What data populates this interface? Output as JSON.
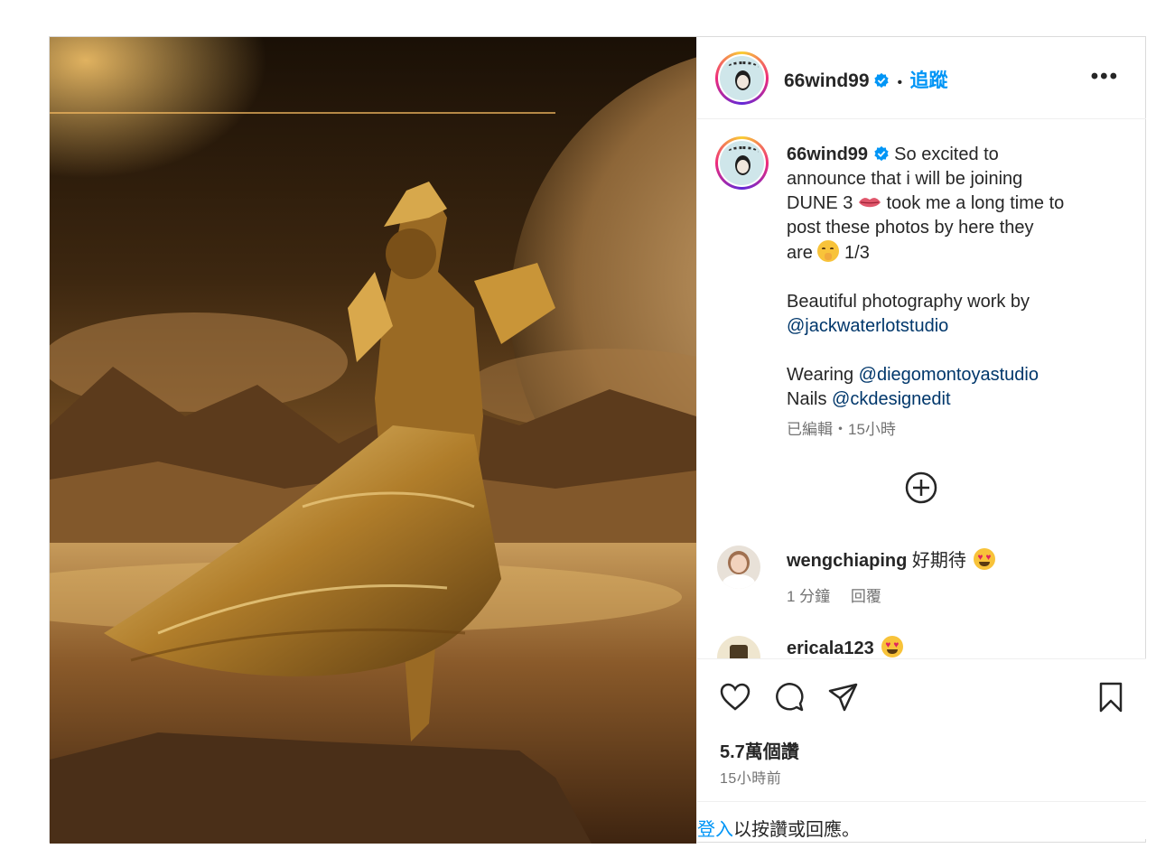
{
  "post": {
    "username": "66wind99",
    "follow_label": "追蹤",
    "dot": "•",
    "more_label": "•••",
    "caption": {
      "line1": "So excited to",
      "line2": "announce that i will be joining",
      "line3": "DUNE 3",
      "line3b": " took me a long time to",
      "line4": "post these photos by here they",
      "line5": "are",
      "line5b": " 1/3",
      "credit": "Beautiful photography work by",
      "credit_link": "@jackwaterlotstudio",
      "wearing": "Wearing ",
      "wearing_link": "@diegomontoyastudio",
      "nails": "Nails ",
      "nails_link": "@ckdesignedit",
      "edited_meta": "已編輯・15小時"
    },
    "comments": [
      {
        "user": "wengchiaping",
        "text": " 好期待",
        "meta_time": "1 分鐘",
        "meta_reply": "回覆"
      },
      {
        "user": "ericala123",
        "text": " "
      }
    ],
    "likes_label": "5.7萬個讚",
    "posted_time": "15小時前",
    "login_link": "登入",
    "login_text": "以按讚或回應。"
  },
  "colors": {
    "accent": "#0095f6",
    "link": "#00376b",
    "text": "#262626",
    "muted": "#737373",
    "border": "#dbdbdb"
  },
  "icons": [
    "verified-badge-icon",
    "more-options-icon",
    "add-comment-icon",
    "heart-icon",
    "comment-icon",
    "share-icon",
    "bookmark-icon",
    "heart-eyes-emoji",
    "lips-emoji",
    "shushing-emoji"
  ]
}
